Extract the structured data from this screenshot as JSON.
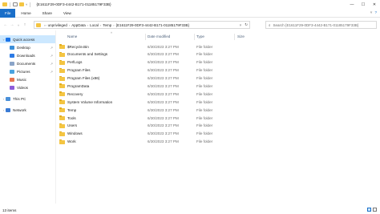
{
  "window": {
    "title": "{E1611F29-0DF3-4442-B171-01185179F33B}",
    "controls": {
      "minimize": "—",
      "maximize": "☐",
      "close": "✕"
    }
  },
  "ribbon": {
    "tabs": [
      "File",
      "Home",
      "Share",
      "View"
    ],
    "right": {
      "collapse": "˅",
      "help": "?"
    }
  },
  "address": {
    "back": "←",
    "forward": "→",
    "recent": "˅",
    "up": "↑",
    "crumbs": [
      "unprivileged",
      "AppData",
      "Local",
      "Temp",
      "{E1611F29-0DF3-4442-B171-01185179F33B}"
    ],
    "dropdown": "˅",
    "refresh": "↻"
  },
  "search": {
    "placeholder": "Search {E1611F29-0DF3-4442-B171-01185179F33B}",
    "icon": "search-icon"
  },
  "nav": {
    "items": [
      {
        "label": "Quick access",
        "icon": "star-icon",
        "color": "#1a73e8",
        "level": 0,
        "active": true
      },
      {
        "label": "Desktop",
        "icon": "desktop-icon",
        "color": "#3b8fd9",
        "level": 1,
        "pinned": true
      },
      {
        "label": "Downloads",
        "icon": "downloads-icon",
        "color": "#2c7be5",
        "level": 1,
        "pinned": true
      },
      {
        "label": "Documents",
        "icon": "documents-icon",
        "color": "#8aa4c8",
        "level": 1,
        "pinned": true
      },
      {
        "label": "Pictures",
        "icon": "pictures-icon",
        "color": "#4aa3df",
        "level": 1,
        "pinned": true
      },
      {
        "label": "Music",
        "icon": "music-icon",
        "color": "#e8744f",
        "level": 1
      },
      {
        "label": "Videos",
        "icon": "videos-icon",
        "color": "#8e5cd9",
        "level": 1
      },
      {
        "label": "This PC",
        "icon": "computer-icon",
        "color": "#4a90d9",
        "level": 0,
        "spaced": true
      },
      {
        "label": "Network",
        "icon": "network-icon",
        "color": "#3a7bd5",
        "level": 0,
        "spaced": true
      }
    ],
    "pin_glyph": "↗"
  },
  "columns": {
    "name": "Name",
    "date": "Date modified",
    "type": "Type",
    "size": "Size",
    "sort_indicator": "˄"
  },
  "files": [
    {
      "name": "$Recycle.Bin",
      "date": "6/30/2023 3:27 PM",
      "type": "File folder"
    },
    {
      "name": "Documents and Settings",
      "date": "6/30/2023 3:27 PM",
      "type": "File folder"
    },
    {
      "name": "PerfLogs",
      "date": "6/30/2023 3:27 PM",
      "type": "File folder"
    },
    {
      "name": "Program Files",
      "date": "6/30/2023 3:27 PM",
      "type": "File folder"
    },
    {
      "name": "Program Files (x86)",
      "date": "6/30/2023 3:27 PM",
      "type": "File folder"
    },
    {
      "name": "ProgramData",
      "date": "6/30/2023 3:27 PM",
      "type": "File folder"
    },
    {
      "name": "Recovery",
      "date": "6/30/2023 3:27 PM",
      "type": "File folder"
    },
    {
      "name": "System Volume Information",
      "date": "6/30/2023 3:27 PM",
      "type": "File folder"
    },
    {
      "name": "Temp",
      "date": "6/30/2023 3:27 PM",
      "type": "File folder"
    },
    {
      "name": "Tools",
      "date": "6/30/2023 3:27 PM",
      "type": "File folder"
    },
    {
      "name": "Users",
      "date": "6/30/2023 3:27 PM",
      "type": "File folder"
    },
    {
      "name": "Windows",
      "date": "6/30/2023 3:27 PM",
      "type": "File folder"
    },
    {
      "name": "Work",
      "date": "6/30/2023 3:27 PM",
      "type": "File folder"
    }
  ],
  "status": {
    "item_count": "13 items"
  },
  "colors": {
    "accent": "#1a6fc9",
    "selection": "#cce8ff",
    "folder": "#f4c542"
  }
}
